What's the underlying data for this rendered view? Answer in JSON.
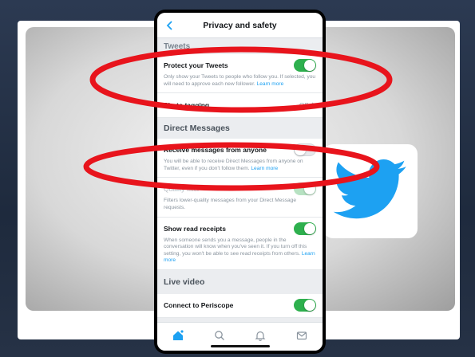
{
  "colors": {
    "accent": "#1da1f2",
    "toggle_on": "#2eb04e",
    "annotation": "#e8141c"
  },
  "nav": {
    "title": "Privacy and safety",
    "back_icon": "chevron-left-icon"
  },
  "sections": {
    "tweets": "Tweets",
    "direct_messages": "Direct Messages",
    "live_video": "Live video"
  },
  "protect_tweets": {
    "label": "Protect your Tweets",
    "toggle": "on",
    "description": "Only show your Tweets to people who follow you. If selected, you will need to approve each new follower.",
    "link": "Learn more"
  },
  "photo_tagging": {
    "label": "Photo tagging",
    "value": "Off"
  },
  "receive_messages": {
    "label": "Receive messages from anyone",
    "toggle": "off",
    "description": "You will be able to receive Direct Messages from anyone on Twitter, even if you don't follow them.",
    "link": "Learn more"
  },
  "quality_filter": {
    "label": "Quality filter",
    "toggle": "on-disabled",
    "description": "Filters lower-quality messages from your Direct Message requests."
  },
  "read_receipts": {
    "label": "Show read receipts",
    "toggle": "on",
    "description": "When someone sends you a message, people in the conversation will know when you've seen it. If you turn off this setting, you won't be able to see read receipts from others.",
    "link": "Learn more"
  },
  "periscope": {
    "label": "Connect to Periscope",
    "toggle": "on"
  },
  "tabbar": {
    "items": [
      "home-icon",
      "search-icon",
      "notifications-bell-icon",
      "messages-envelope-icon"
    ]
  },
  "side_logo": "twitter-bird-icon"
}
